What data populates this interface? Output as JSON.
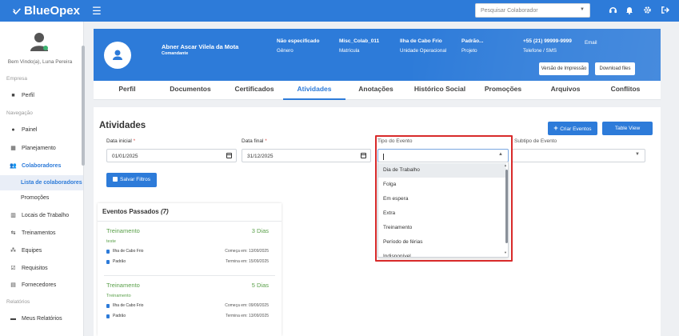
{
  "app": {
    "brand": "BlueOpex",
    "search_placeholder": "Pesquisar Colaborador"
  },
  "sidebar": {
    "welcome": "Bem Vindo(a), Luna Pereira",
    "sections": {
      "empresa": "Empresa",
      "navegacao": "Navegação",
      "relatorios": "Relatórios"
    },
    "items": {
      "perfil": "Perfil",
      "painel": "Painel",
      "planejamento": "Planejamento",
      "colaboradores": "Colaboradores",
      "lista": "Lista de colaboradores",
      "promocoes": "Promoções",
      "locais": "Locais de Trabalho",
      "treinamentos": "Treinamentos",
      "equipes": "Equipes",
      "requisitos": "Requisitos",
      "fornecedores": "Fornecedores",
      "meus_relatorios": "Meus Relatórios"
    }
  },
  "profile": {
    "name": "Abner Ascar Vilela da Mota",
    "role": "Comandante",
    "genero_value": "Não especificado",
    "genero_label": "Gênero",
    "matricula_value": "Misc_Colab_011",
    "matricula_label": "Matrícula",
    "unidade_value": "Ilha de Cabo Frio",
    "unidade_label": "Unidade Operacional",
    "projeto_value": "Padrão...",
    "projeto_label": "Projeto",
    "telefone_value": "+55 (21) 99999-9999",
    "telefone_label": "Telefone / SMS",
    "email_label": "Email",
    "print_button": "Versão de Impressão",
    "download_button": "Download files"
  },
  "tabs": [
    "Perfil",
    "Documentos",
    "Certificados",
    "Atividades",
    "Anotações",
    "Histórico Social",
    "Promoções",
    "Arquivos",
    "Conflitos"
  ],
  "activities": {
    "title": "Atividades",
    "create_button": "Criar Eventos",
    "table_view_button": "Table View",
    "data_inicial_label": "Data inicial",
    "data_inicial_value": "01/01/2025",
    "data_final_label": "Data final",
    "data_final_value": "31/12/2025",
    "tipo_label": "Tipo do Evento",
    "subtipo_label": "Subtipo de Evento",
    "save_filters": "Salvar Filtros",
    "dropdown_options": [
      "Dia de Trabalho",
      "Folga",
      "Em espera",
      "Extra",
      "Treinamento",
      "Período de férias",
      "Indisponível"
    ]
  },
  "events": {
    "title": "Eventos Passados",
    "count": "(7)",
    "items": [
      {
        "title": "Treinamento",
        "days": "3 Dias",
        "desc": "teste",
        "loc": "Ilha de Cabo Frio",
        "proj": "Padrão",
        "start": "Começa em: 13/09/2025",
        "end": "Termina em: 15/09/2025"
      },
      {
        "title": "Treinamento",
        "days": "5 Dias",
        "desc": "Treinamento",
        "loc": "Ilha de Cabo Frio",
        "proj": "Padrão",
        "start": "Começa em: 09/09/2025",
        "end": "Termina em: 13/09/2025"
      }
    ]
  },
  "colors": {
    "primary": "#2d7bd9",
    "success": "#5aa04a",
    "highlight": "#d82a2a"
  }
}
